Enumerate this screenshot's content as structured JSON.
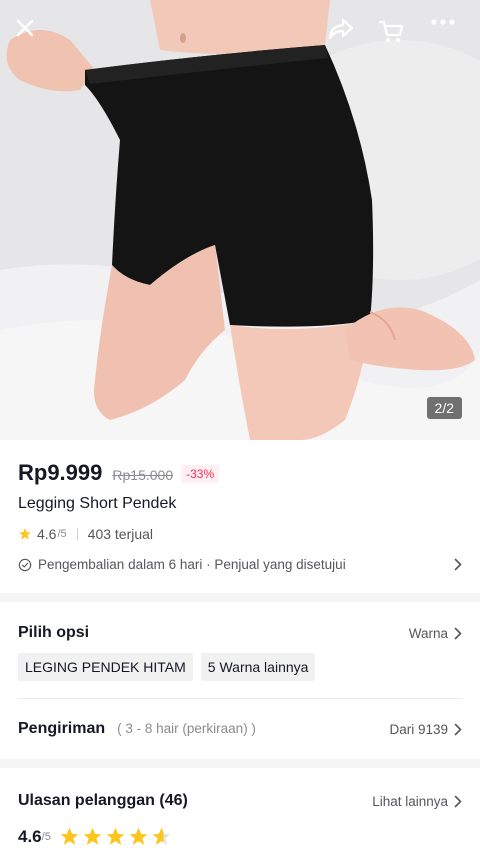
{
  "product_image": {
    "counter": "2/2"
  },
  "topbar": {
    "icons": [
      "close-icon",
      "share-icon",
      "cart-icon",
      "more-icon"
    ]
  },
  "product": {
    "price": "Rp9.999",
    "original_price": "Rp15.000",
    "discount": "-33%",
    "title": "Legging Short Pendek",
    "rating": "4.6",
    "rating_scale": "/5",
    "sold": "403 terjual",
    "return_policy": "Pengembalian dalam 6 hari · Penjual yang disetujui"
  },
  "options": {
    "title": "Pilih opsi",
    "link": "Warna",
    "chips": [
      "LEGING PENDEK HITAM",
      "5 Warna lainnya"
    ]
  },
  "shipping": {
    "title": "Pengiriman",
    "estimate": "( 3 - 8 hair (perkiraan) )",
    "from": "Dari 9139"
  },
  "reviews": {
    "title": "Ulasan pelanggan (46)",
    "link": "Lihat lainnya",
    "score": "4.6",
    "scale": "/5",
    "stars": 4.6
  },
  "colors": {
    "accent": "#fe2c55",
    "star": "#fcc61d"
  }
}
